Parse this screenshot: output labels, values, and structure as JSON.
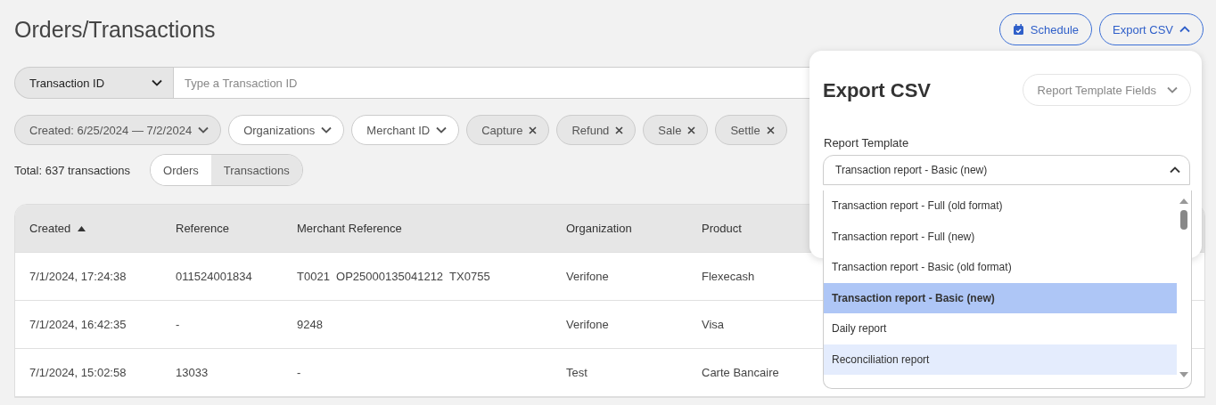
{
  "page": {
    "title": "Orders/Transactions"
  },
  "header_buttons": [
    {
      "label": "Schedule",
      "kind": "schedule"
    },
    {
      "label": "Export CSV",
      "kind": "export",
      "expanded": true
    }
  ],
  "search": {
    "field_type": "Transaction ID",
    "placeholder": "Type a Transaction ID"
  },
  "filters": [
    {
      "label": "Created: 6/25/2024 — 7/2/2024",
      "kind": "dropdown",
      "active": true
    },
    {
      "label": "Organizations",
      "kind": "dropdown",
      "active": false
    },
    {
      "label": "Merchant ID",
      "kind": "dropdown",
      "active": false
    },
    {
      "label": "Capture",
      "kind": "removable",
      "active": true
    },
    {
      "label": "Refund",
      "kind": "removable",
      "active": true
    },
    {
      "label": "Sale",
      "kind": "removable",
      "active": true
    },
    {
      "label": "Settle",
      "kind": "removable",
      "active": true
    }
  ],
  "total": "Total: 637 transactions",
  "view_tabs": [
    {
      "label": "Orders",
      "selected": false
    },
    {
      "label": "Transactions",
      "selected": true
    }
  ],
  "table": {
    "columns": [
      {
        "label": "Created",
        "sorted": true
      },
      {
        "label": "Reference",
        "sorted": false
      },
      {
        "label": "Merchant Reference",
        "sorted": false
      },
      {
        "label": "Organization",
        "sorted": false
      },
      {
        "label": "Product",
        "sorted": false
      }
    ],
    "rows": [
      [
        "7/1/2024, 17:24:38",
        "011524001834",
        "T0021  OP25000135041212  TX0755",
        "Verifone",
        "Flexecash"
      ],
      [
        "7/1/2024, 16:42:35",
        "-",
        "9248",
        "Verifone",
        "Visa"
      ],
      [
        "7/1/2024, 15:02:58",
        "13033",
        "-",
        "Test",
        "Carte Bancaire"
      ]
    ]
  },
  "export_panel": {
    "title": "Export CSV",
    "fields_dropdown": "Report Template Fields",
    "template_label": "Report Template",
    "template_value": "Transaction report - Basic (new)",
    "options": [
      {
        "label": "Transaction report - Full (old format)",
        "selected": false,
        "hovered": false
      },
      {
        "label": "Transaction report - Full (new)",
        "selected": false,
        "hovered": false
      },
      {
        "label": "Transaction report - Basic (old format)",
        "selected": false,
        "hovered": false
      },
      {
        "label": "Transaction report - Basic (new)",
        "selected": true,
        "hovered": false
      },
      {
        "label": "Daily report",
        "selected": false,
        "hovered": false
      },
      {
        "label": "Reconciliation report",
        "selected": false,
        "hovered": true
      }
    ]
  }
}
